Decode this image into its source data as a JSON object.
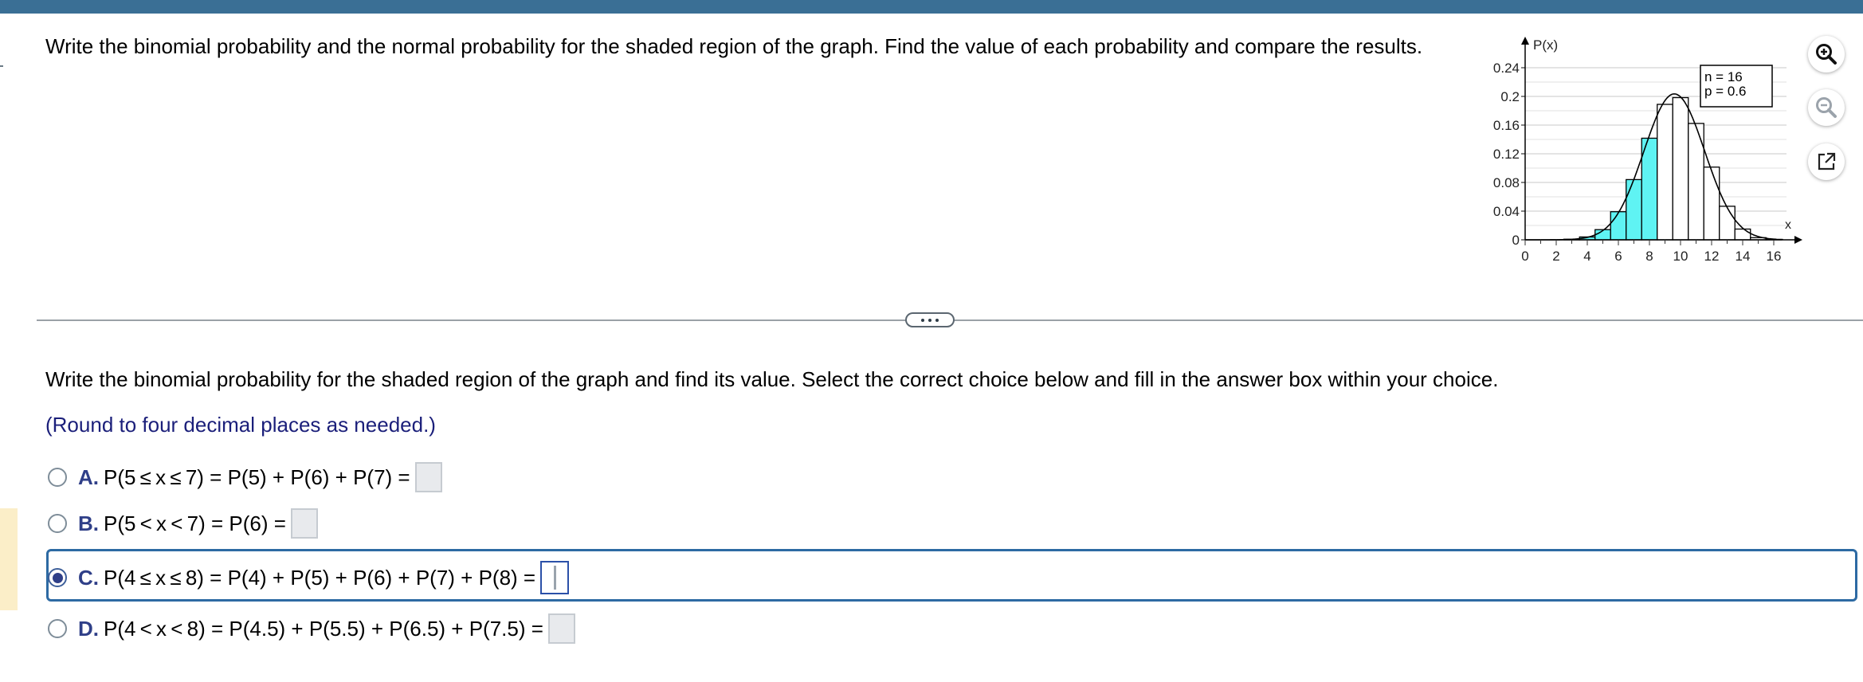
{
  "question": "Write the binomial probability and the normal probability for the shaded region of the graph. Find the value of each probability and compare the results.",
  "instruction": "Write the binomial probability for the shaded region of the graph and find its value. Select the correct choice below and fill in the answer box within your choice.",
  "round_note": "(Round to four decimal places as needed.)",
  "choices": [
    {
      "letter": "A.",
      "expr": "P(5 ≤ x ≤ 7) = P(5) + P(6) + P(7) =",
      "selected": false
    },
    {
      "letter": "B.",
      "expr": "P(5 < x < 7) = P(6) =",
      "selected": false
    },
    {
      "letter": "C.",
      "expr": "P(4 ≤ x ≤ 8) = P(4) + P(5) + P(6) + P(7) + P(8) =",
      "selected": true
    },
    {
      "letter": "D.",
      "expr": "P(4 < x < 8) = P(4.5) + P(5.5) + P(6.5) + P(7.5) =",
      "selected": false
    }
  ],
  "tools": {
    "zoom_in": "zoom-in-icon",
    "zoom_out": "zoom-out-icon",
    "pop_out": "pop-out-icon"
  },
  "colors": {
    "accent": "#3a6f95",
    "shade": "#5ff3f3",
    "choice_letter": "#2f3f88"
  },
  "chart_data": {
    "type": "bar",
    "ylabel": "P(x)",
    "xlabel": "x",
    "legend": [
      "n = 16",
      "p = 0.6"
    ],
    "x": [
      0,
      1,
      2,
      3,
      4,
      5,
      6,
      7,
      8,
      9,
      10,
      11,
      12,
      13,
      14,
      15,
      16
    ],
    "values": [
      0.0,
      0.0,
      0.0,
      0.0008,
      0.004,
      0.0142,
      0.0392,
      0.084,
      0.1417,
      0.1889,
      0.1983,
      0.1623,
      0.1014,
      0.0468,
      0.015,
      0.003,
      0.0003
    ],
    "shaded_x": [
      4,
      5,
      6,
      7,
      8
    ],
    "x_ticks": [
      0,
      2,
      4,
      6,
      8,
      10,
      12,
      14,
      16
    ],
    "y_ticks": [
      "0",
      "0.04",
      "0.08",
      "0.12",
      "0.16",
      "0.2",
      "0.24"
    ],
    "ylim": [
      0,
      0.24
    ],
    "xlim": [
      0,
      16
    ],
    "grid": true,
    "normal_curve": {
      "mean": 9.6,
      "sd": 1.96
    }
  }
}
